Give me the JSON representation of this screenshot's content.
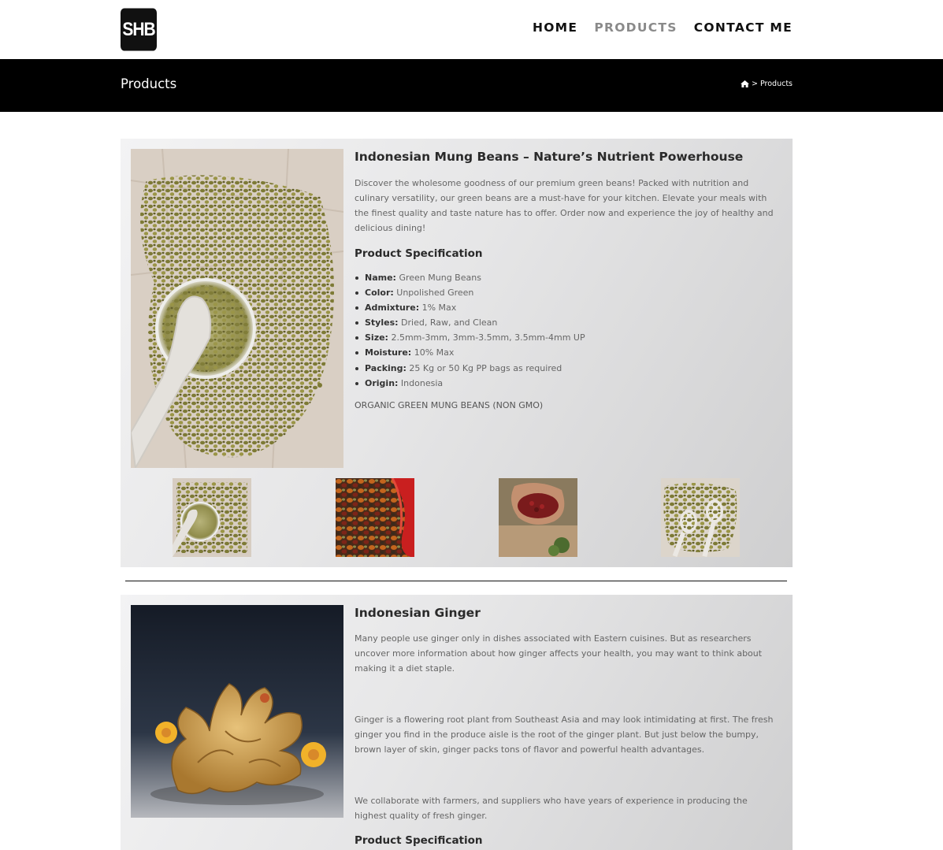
{
  "header": {
    "logo_text": "SHB",
    "nav": [
      {
        "label": "HOME",
        "active": false
      },
      {
        "label": "PRODUCTS",
        "active": true
      },
      {
        "label": "CONTACT ME",
        "active": false
      }
    ]
  },
  "titlebar": {
    "title": "Products",
    "breadcrumb": {
      "icon": "home-icon",
      "separator": ">",
      "current": "Products"
    }
  },
  "products": [
    {
      "title": "Indonesian Mung Beans – Nature’s Nutrient Powerhouse",
      "description": "Discover the wholesome goodness of our premium green beans! Packed with nutrition and culinary versatility, our green beans are a must-have for your kitchen. Elevate your meals with the finest quality and taste nature has to offer. Order now and experience the joy of healthy and delicious dining!",
      "spec_title": "Product Specification",
      "specs": [
        {
          "key": "Name:",
          "value": "Green Mung Beans"
        },
        {
          "key": "Color:",
          "value": "Unpolished Green"
        },
        {
          "key": "Admixture:",
          "value": "1% Max"
        },
        {
          "key": "Styles:",
          "value": "Dried, Raw, and Clean"
        },
        {
          "key": "Size:",
          "value": "2.5mm-3mm, 3mm-3.5mm, 3.5mm-4mm UP"
        },
        {
          "key": "Moisture:",
          "value": "10% Max"
        },
        {
          "key": "Packing:",
          "value": "25 Kg or 50 Kg PP bags as required"
        },
        {
          "key": "Origin:",
          "value": "Indonesia"
        }
      ],
      "tagline": "ORGANIC GREEN MUNG BEANS (NON GMO)",
      "thumbnails": [
        "mung-beans-bowl",
        "mixed-seeds",
        "coffee-cherries-hands",
        "mung-beans-spoons"
      ]
    },
    {
      "title": "Indonesian Ginger",
      "paragraphs": [
        "Many people use ginger only in dishes associated with Eastern cuisines. But as researchers uncover more information about how ginger affects your health, you may want to think about making it a diet staple.",
        "Ginger is a flowering root plant from Southeast Asia and may look intimidating at first. The fresh ginger you find in the produce aisle is the root of the ginger plant. But just below the bumpy, brown layer of skin, ginger packs tons of flavor and powerful health advantages.",
        "We collaborate with farmers, and suppliers who have years of experience in producing the highest quality of fresh ginger."
      ],
      "spec_title": "Product Specification"
    }
  ],
  "colors": {
    "accent_dark": "#000000",
    "nav_active": "#8a8a8a",
    "text": "#666666"
  }
}
